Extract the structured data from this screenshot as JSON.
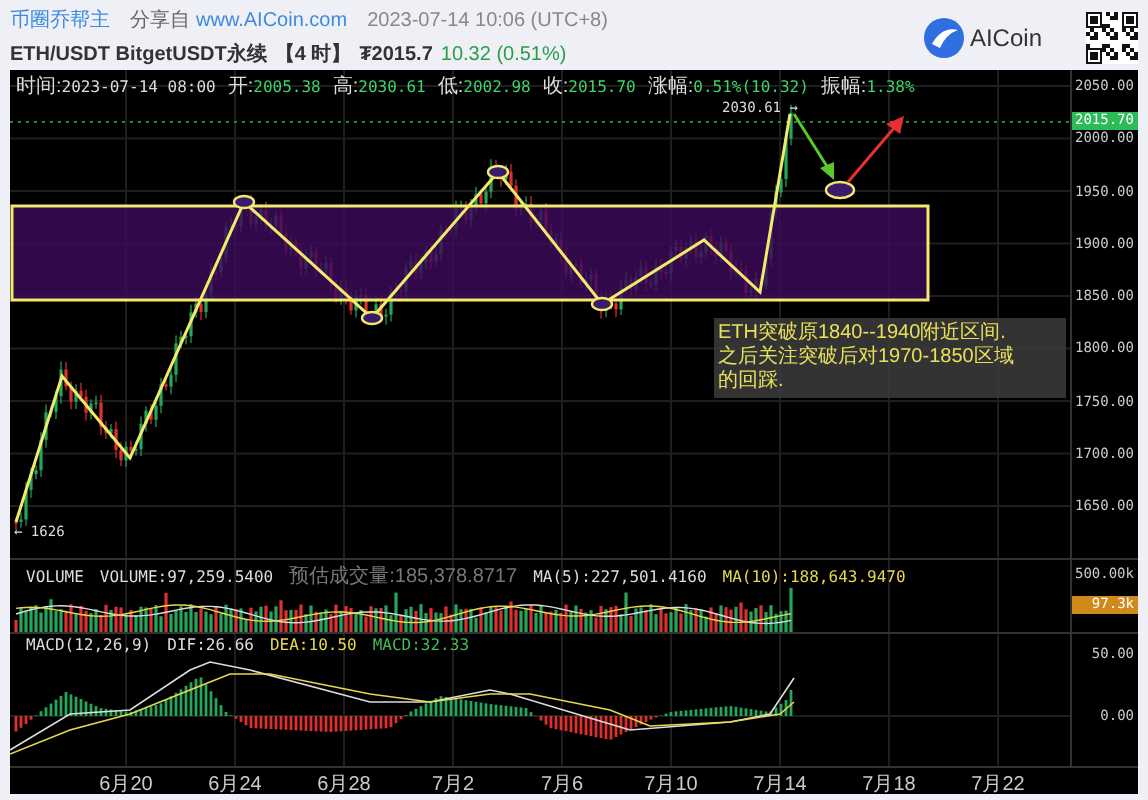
{
  "header": {
    "author": "币圈乔帮主",
    "share_prefix": "分享自",
    "share_link": "www.AICoin.com",
    "timestamp": "2023-07-14 10:06 (UTC+8)",
    "pair": "ETH/USDT BitgetUSDT永续",
    "interval": "【4 时】",
    "price": "₮2015.7",
    "change": "10.32 (0.51%)",
    "logo_text": "AICoin"
  },
  "info_bar": [
    {
      "label": "时间:",
      "value": "2023-07-14 08:00",
      "kind": "plain"
    },
    {
      "label": "开:",
      "value": "2005.38",
      "kind": "quote"
    },
    {
      "label": "高:",
      "value": "2030.61",
      "kind": "quote"
    },
    {
      "label": "低:",
      "value": "2002.98",
      "kind": "quote"
    },
    {
      "label": "收:",
      "value": "2015.70",
      "kind": "quote"
    },
    {
      "label": "涨幅:",
      "value": "0.51%(10.32)",
      "kind": "quote"
    },
    {
      "label": "振幅:",
      "value": "1.38%",
      "kind": "quote"
    }
  ],
  "price_chart": {
    "high_label": "2030.61 →",
    "low_label": "← 1626",
    "current_price": "2015.70",
    "annotation": [
      "ETH突破原1840--1940附近区间.",
      "之后关注突破后对1970-1850区域",
      "的回踩."
    ],
    "axis": [
      "2050.00",
      "2000.00",
      "1950.00",
      "1900.00",
      "1850.00",
      "1800.00",
      "1750.00",
      "1700.00",
      "1650.00"
    ]
  },
  "volume": {
    "title": "VOLUME",
    "readings": [
      {
        "text": "VOLUME:97,259.5400",
        "kind": "plain"
      },
      {
        "text": "预估成交量:185,378.8717",
        "kind": "muted"
      },
      {
        "text": "MA(5):227,501.4160",
        "kind": "plain"
      },
      {
        "text": "MA(10):188,643.9470",
        "kind": "ma10"
      }
    ],
    "axis": [
      "500.00k"
    ],
    "current": "97.3k"
  },
  "macd": {
    "title": "MACD(12,26,9)",
    "readings": [
      {
        "text": "DIF:26.66",
        "kind": "plain"
      },
      {
        "text": "DEA:10.50",
        "kind": "ma10"
      },
      {
        "text": "MACD:32.33",
        "kind": "macd"
      }
    ],
    "axis": [
      "50.00",
      "0.00"
    ]
  },
  "x_axis": [
    "6月20",
    "6月24",
    "6月28",
    "7月2",
    "7月6",
    "7月10",
    "7月14",
    "7月18",
    "7月22"
  ]
}
